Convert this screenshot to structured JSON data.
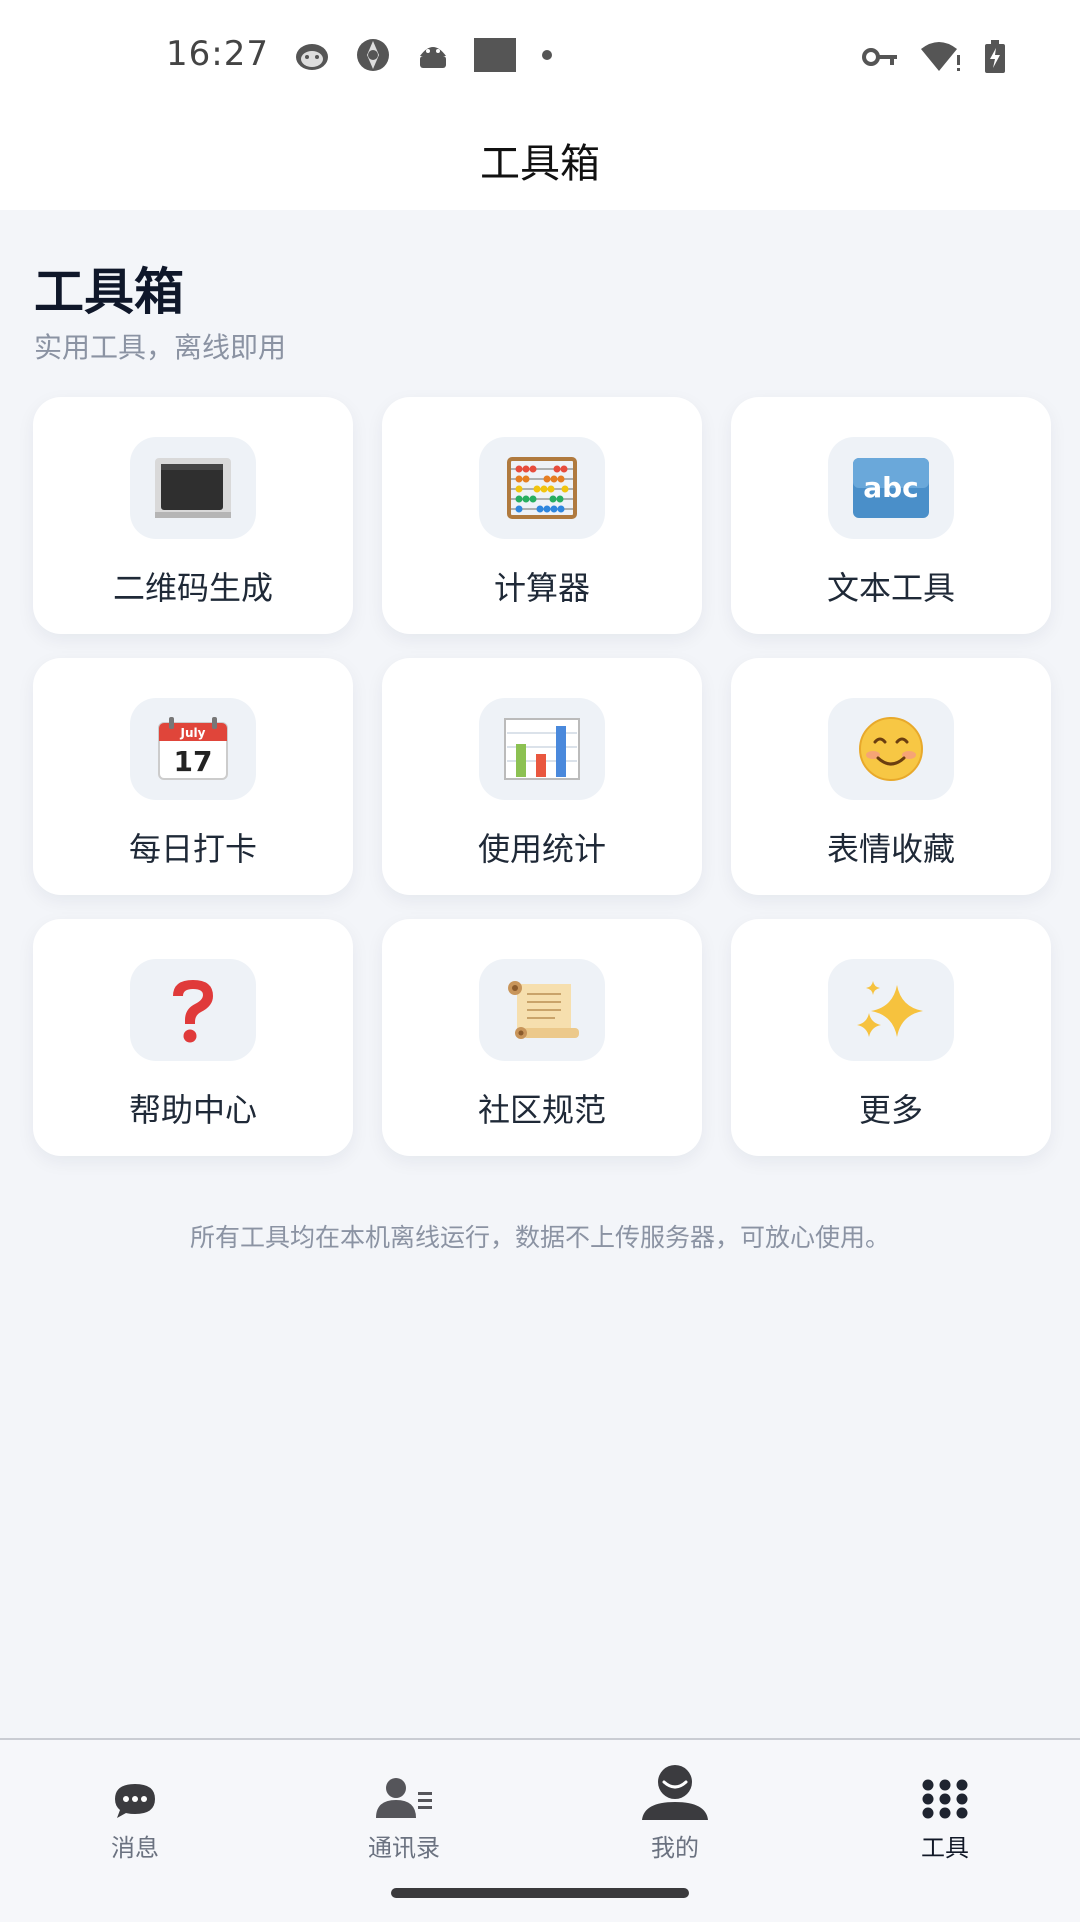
{
  "status_bar": {
    "time": "16:27",
    "left_icons": [
      "cat-face-icon",
      "aperture-icon",
      "android-icon",
      "square-icon",
      "dot-icon"
    ],
    "right_icons": [
      "key-icon",
      "wifi-alert-icon",
      "battery-charging-icon"
    ]
  },
  "header": {
    "title": "工具箱"
  },
  "section": {
    "title": "工具箱",
    "subtitle": "实用工具，离线即用"
  },
  "tools": [
    {
      "label": "二维码生成",
      "icon": "qr-square-icon"
    },
    {
      "label": "计算器",
      "icon": "abacus-icon"
    },
    {
      "label": "文本工具",
      "icon": "abc-icon"
    },
    {
      "label": "每日打卡",
      "icon": "calendar-icon",
      "calendar_month": "July",
      "calendar_day": "17"
    },
    {
      "label": "使用统计",
      "icon": "bar-chart-icon"
    },
    {
      "label": "表情收藏",
      "icon": "smiley-icon"
    },
    {
      "label": "帮助中心",
      "icon": "question-icon"
    },
    {
      "label": "社区规范",
      "icon": "scroll-icon"
    },
    {
      "label": "更多",
      "icon": "sparkles-icon"
    }
  ],
  "footer_note": "所有工具均在本机离线运行，数据不上传服务器，可放心使用。",
  "bottom_nav": [
    {
      "label": "消息",
      "icon": "chat-bubble-icon",
      "active": false
    },
    {
      "label": "通讯录",
      "icon": "contacts-icon",
      "active": false
    },
    {
      "label": "我的",
      "icon": "profile-icon",
      "active": false
    },
    {
      "label": "工具",
      "icon": "grid-dots-icon",
      "active": true
    }
  ],
  "colors": {
    "background": "#f3f5f9",
    "card": "#ffffff",
    "icon_box": "#eef2f7",
    "subtitle": "#8b93a3",
    "title": "#0f172a"
  }
}
